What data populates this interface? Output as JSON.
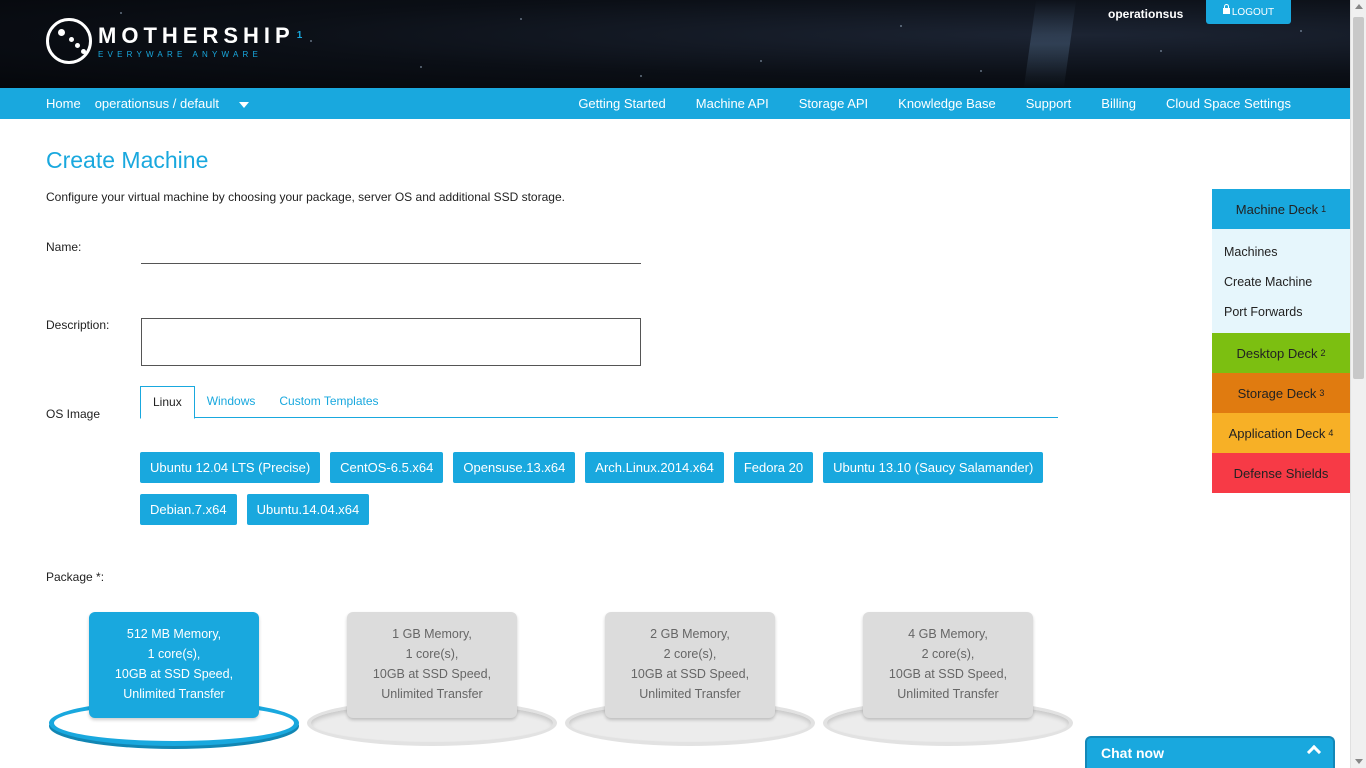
{
  "header": {
    "brand": "MOTHERSHIP",
    "brand_sup": "1",
    "tagline": "EVERYWARE ANYWARE",
    "user": "operationsus",
    "logout": "LOGOUT"
  },
  "nav": {
    "home": "Home",
    "space": "operationsus / default",
    "links": [
      "Getting Started",
      "Machine API",
      "Storage API",
      "Knowledge Base",
      "Support",
      "Billing",
      "Cloud Space Settings"
    ]
  },
  "main": {
    "title": "Create Machine",
    "intro": "Configure your virtual machine by choosing your package, server OS and additional SSD storage.",
    "name_label": "Name:",
    "description_label": "Description:",
    "os_label": "OS Image",
    "tabs": [
      "Linux",
      "Windows",
      "Custom Templates"
    ],
    "os_images": [
      "Ubuntu 12.04 LTS (Precise)",
      "CentOS-6.5.x64",
      "Opensuse.13.x64",
      "Arch.Linux.2014.x64",
      "Fedora 20",
      "Ubuntu 13.10 (Saucy Salamander)",
      "Debian.7.x64",
      "Ubuntu.14.04.x64"
    ],
    "package_label": "Package *:",
    "packages": [
      {
        "l1": "512 MB Memory,",
        "l2": "1 core(s),",
        "l3": "10GB at SSD Speed,",
        "l4": "Unlimited Transfer"
      },
      {
        "l1": "1 GB Memory,",
        "l2": "1 core(s),",
        "l3": "10GB at SSD Speed,",
        "l4": "Unlimited Transfer"
      },
      {
        "l1": "2 GB Memory,",
        "l2": "2 core(s),",
        "l3": "10GB at SSD Speed,",
        "l4": "Unlimited Transfer"
      },
      {
        "l1": "4 GB Memory,",
        "l2": "2 core(s),",
        "l3": "10GB at SSD Speed,",
        "l4": "Unlimited Transfer"
      }
    ]
  },
  "deck": {
    "machine": {
      "label": "Machine Deck",
      "sup": "1"
    },
    "machine_items": [
      "Machines",
      "Create Machine",
      "Port Forwards"
    ],
    "desktop": {
      "label": "Desktop Deck",
      "sup": "2"
    },
    "storage": {
      "label": "Storage Deck",
      "sup": "3"
    },
    "application": {
      "label": "Application Deck",
      "sup": "4"
    },
    "defense": {
      "label": "Defense Shields"
    }
  },
  "chat": {
    "label": "Chat now"
  },
  "colors": {
    "accent": "#19a8de",
    "desktop": "#7cbf11",
    "storage": "#e07b10",
    "application": "#f7b026",
    "defense": "#f73a46"
  }
}
